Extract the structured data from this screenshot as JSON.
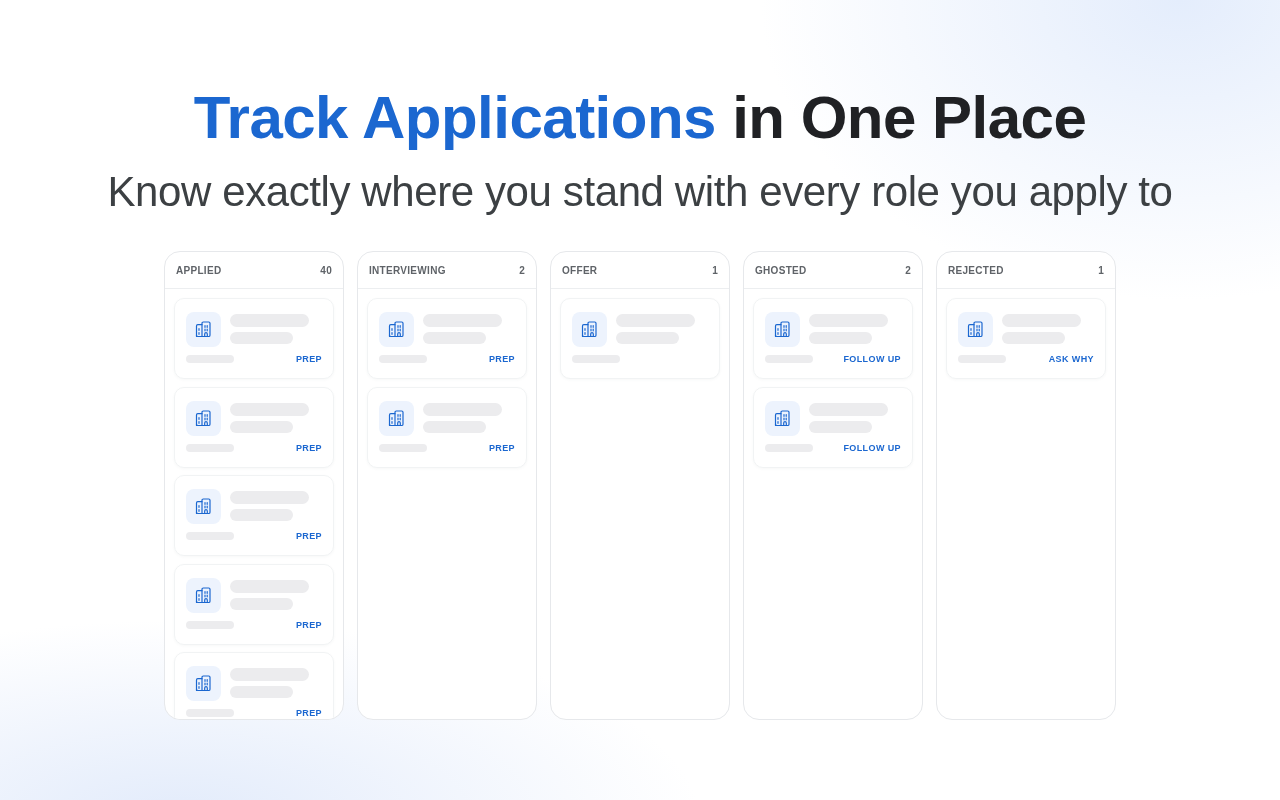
{
  "headline": {
    "highlight": "Track Applications",
    "rest": "in One Place"
  },
  "subtitle": "Know exactly where you stand with every role you apply to",
  "columns": [
    {
      "title": "APPLIED",
      "count": "40",
      "cards": [
        {
          "kind": "skeleton",
          "action": "PREP"
        },
        {
          "kind": "skeleton",
          "action": "PREP"
        },
        {
          "kind": "skeleton",
          "action": "PREP"
        },
        {
          "kind": "skeleton",
          "action": "PREP"
        },
        {
          "kind": "skeleton",
          "action": "PREP"
        }
      ]
    },
    {
      "title": "INTERVIEWING",
      "count": "2",
      "cards": [
        {
          "kind": "skeleton",
          "action": "PREP"
        },
        {
          "kind": "skeleton",
          "action": "PREP"
        }
      ]
    },
    {
      "title": "OFFER",
      "count": "1",
      "cards": [
        {
          "kind": "skeleton"
        }
      ]
    },
    {
      "title": "GHOSTED",
      "count": "2",
      "cards": [
        {
          "kind": "skeleton",
          "action": "FOLLOW UP"
        },
        {
          "kind": "skeleton",
          "action": "FOLLOW UP"
        }
      ]
    },
    {
      "title": "REJECTED",
      "count": "1",
      "cards": [
        {
          "kind": "skeleton",
          "action": "ASK WHY"
        }
      ]
    }
  ]
}
